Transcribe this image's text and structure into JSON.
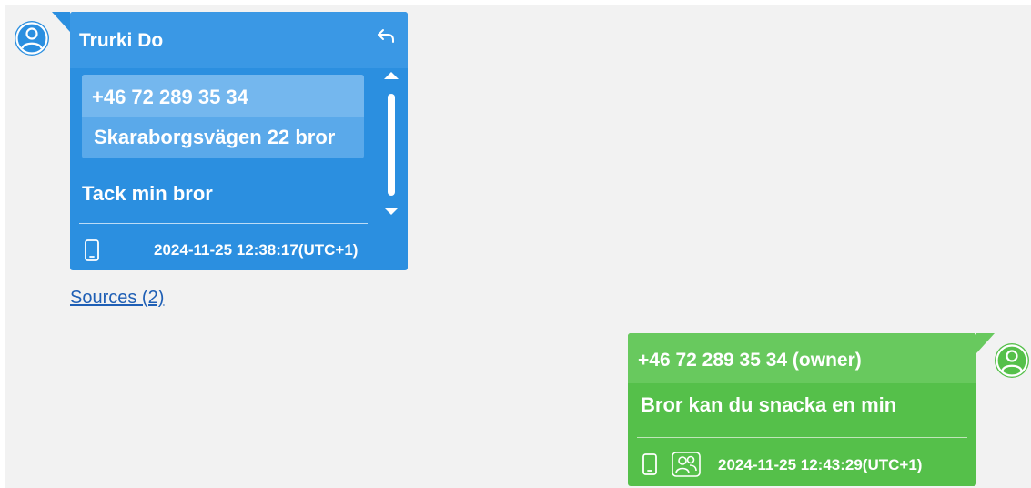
{
  "incoming": {
    "sender": "Trurki Do",
    "quote": {
      "line1": "+46 72 289 35 34",
      "line2": "Skaraborgsvägen 22 bror"
    },
    "message": "Tack min bror",
    "timestamp": "2024-11-25 12:38:17(UTC+1)",
    "color": "#2b8fe0"
  },
  "sources_link": "Sources (2)",
  "outgoing": {
    "sender": "+46 72 289 35 34 (owner)",
    "message": "Bror kan du snacka en min",
    "timestamp": "2024-11-25 12:43:29(UTC+1)",
    "color": "#55c04a"
  },
  "icons": {
    "incoming_avatar": "user-avatar-icon",
    "outgoing_avatar": "user-avatar-icon",
    "reply": "reply-icon",
    "device": "mobile-phone-icon",
    "group": "group-icon"
  }
}
